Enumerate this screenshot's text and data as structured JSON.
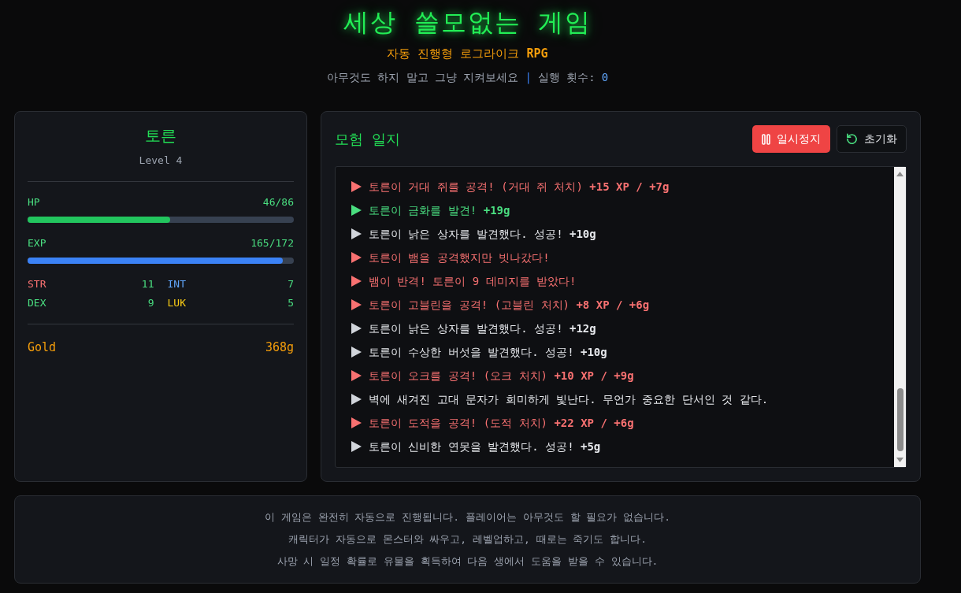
{
  "header": {
    "title": "세상 쓸모없는 게임",
    "subtitle": "자동 진행형 로그라이크 **RPG**",
    "tagline": "아무것도 하지 말고 그냥 지켜보세요",
    "separator": "|",
    "run_count_label": "실행 횟수:",
    "run_count": "0"
  },
  "character": {
    "name": "토른",
    "level": "Level 4",
    "meters": [
      {
        "kind": "hp",
        "label": "HP",
        "reading": "46/86",
        "level": 0.535
      },
      {
        "kind": "exp",
        "label": "EXP",
        "reading": "165/172",
        "level": 0.96
      }
    ],
    "stats": [
      {
        "label": "STR",
        "value": "11",
        "color": "#f87171"
      },
      {
        "label": "INT",
        "value": "7",
        "color": "#60a5fa"
      },
      {
        "label": "DEX",
        "value": "9",
        "color": "#4ade80"
      },
      {
        "label": "LUK",
        "value": "5",
        "color": "#facc15"
      }
    ],
    "gold": {
      "label": "Gold",
      "value": "368g"
    }
  },
  "log": {
    "title": "모험 일지",
    "buttons": [
      {
        "kind": "pause",
        "label": "일시정지"
      },
      {
        "kind": "reset",
        "label": "초기화"
      }
    ],
    "entries": [
      {
        "kind": "combat",
        "text": "토른이 거대 쥐를 공격! (거대 쥐 처치) **+15 XP / +7g**"
      },
      {
        "kind": "loot",
        "text": "토른이 금화를 발견! **+19g**"
      },
      {
        "kind": "event",
        "text": "토른이 낡은 상자를 발견했다. 성공! **+10g**"
      },
      {
        "kind": "combat",
        "text": "토른이 뱀을 공격했지만 빗나갔다!"
      },
      {
        "kind": "combat",
        "text": "뱀이 반격! 토른이 9 데미지를 받았다!"
      },
      {
        "kind": "combat",
        "text": "토른이 고블린을 공격! (고블린 처치) **+8 XP / +6g**"
      },
      {
        "kind": "event",
        "text": "토른이 낡은 상자를 발견했다. 성공! **+12g**"
      },
      {
        "kind": "event",
        "text": "토른이 수상한 버섯을 발견했다. 성공! **+10g**"
      },
      {
        "kind": "combat",
        "text": "토른이 오크를 공격! (오크 처치) **+10 XP / +9g**"
      },
      {
        "kind": "event",
        "text": "벽에 새겨진 고대 문자가 희미하게 빛난다. 무언가 중요한 단서인 것 같다."
      },
      {
        "kind": "combat",
        "text": "토른이 도적을 공격! (도적 처치) **+22 XP / +6g**"
      },
      {
        "kind": "event",
        "text": "토른이 신비한 연못을 발견했다. 성공! **+5g**"
      }
    ]
  },
  "footer": {
    "lines": [
      "이 게임은 완전히 자동으로 진행됩니다. 플레이어는 아무것도 할 필요가 없습니다.",
      "캐릭터가 자동으로 몬스터와 싸우고, 레벨업하고, 때로는 죽기도 합니다.",
      "사망 시 일정 확률로 유물을 획득하여 다음 생에서 도움을 받을 수 있습니다."
    ]
  }
}
